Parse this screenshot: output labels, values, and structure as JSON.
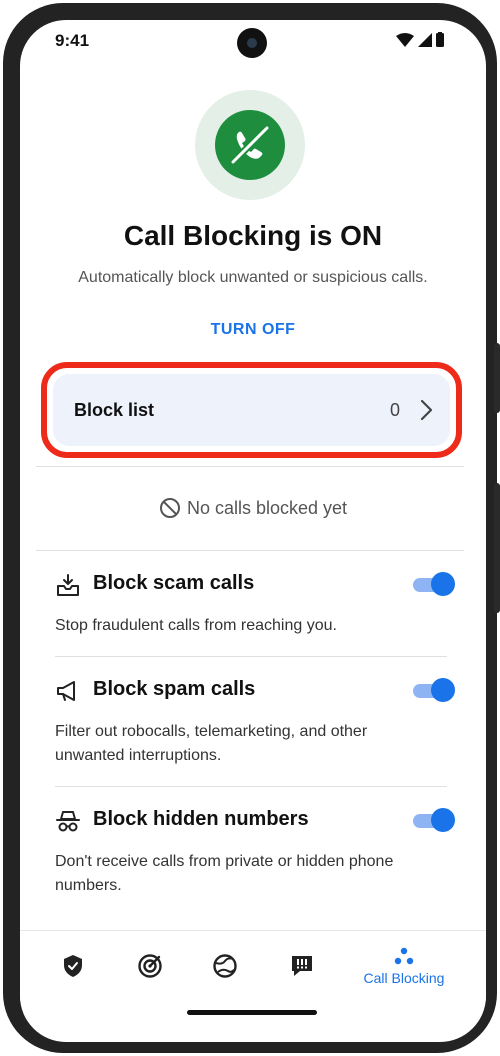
{
  "status_bar": {
    "time": "9:41"
  },
  "header": {
    "title": "Call Blocking is ON",
    "subtitle": "Automatically block unwanted or suspicious calls.",
    "turn_off_label": "TURN OFF"
  },
  "block_list": {
    "label": "Block list",
    "count": "0"
  },
  "no_calls_text": "No calls blocked yet",
  "settings": [
    {
      "title": "Block scam calls",
      "description": "Stop fraudulent calls from reaching you.",
      "enabled": true,
      "icon": "inbox-tray-icon"
    },
    {
      "title": "Block spam calls",
      "description": "Filter out robocalls, telemarketing, and other unwanted interruptions.",
      "enabled": true,
      "icon": "megaphone-icon"
    },
    {
      "title": "Block hidden numbers",
      "description": "Don't receive calls from private or hidden phone numbers.",
      "enabled": true,
      "icon": "incognito-icon"
    }
  ],
  "nav": {
    "items": [
      {
        "icon": "shield-check-icon"
      },
      {
        "icon": "target-icon"
      },
      {
        "icon": "web-ball-icon"
      },
      {
        "icon": "alert-message-icon"
      },
      {
        "icon": "dots-icon",
        "label": "Call Blocking",
        "active": true
      }
    ]
  },
  "colors": {
    "accent": "#1a73e8",
    "brand_green": "#1e8e3e",
    "highlight_red": "#ee2a1a",
    "card_bg": "#eef2fb"
  }
}
